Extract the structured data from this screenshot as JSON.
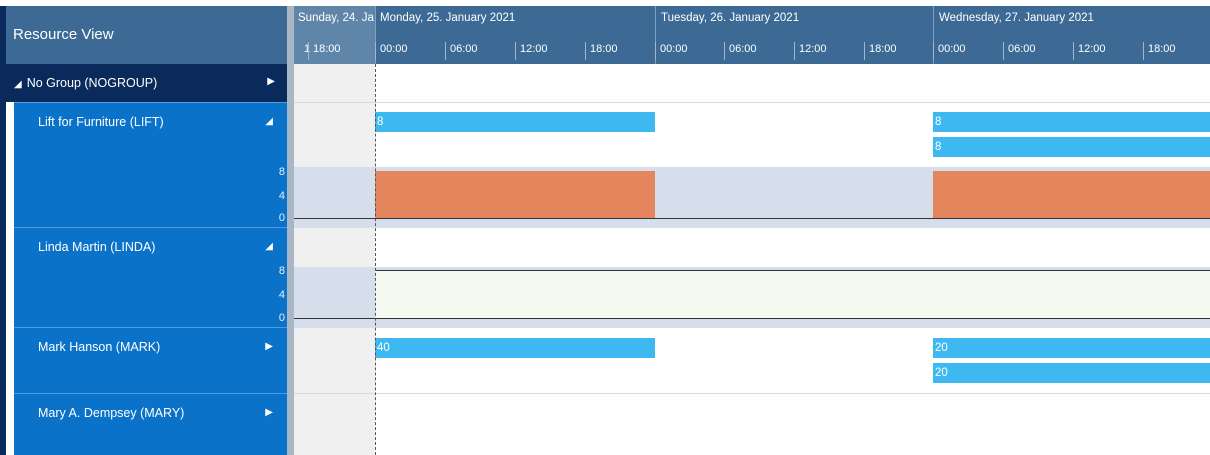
{
  "resource_view": {
    "title": "Resource View",
    "group": {
      "label": "No Group (NOGROUP)",
      "expand_glyph": "◢",
      "arrow_glyph": "▶"
    },
    "resources": [
      {
        "label": "Lift for Furniture (LIFT)",
        "toggle_glyph": "◢",
        "axis": [
          "8",
          "4",
          "0"
        ]
      },
      {
        "label": "Linda Martin (LINDA)",
        "toggle_glyph": "◢",
        "axis": [
          "8",
          "4",
          "0"
        ]
      },
      {
        "label": "Mark Hanson (MARK)",
        "toggle_glyph": "▶"
      },
      {
        "label": "Mary A. Dempsey (MARY)",
        "toggle_glyph": "▶"
      }
    ]
  },
  "timeline": {
    "days": [
      {
        "label": "Sunday, 24. Ja"
      },
      {
        "label": "Monday, 25. January 2021"
      },
      {
        "label": "Tuesday, 26. January 2021"
      },
      {
        "label": "Wednesday, 27. January 2021"
      }
    ],
    "hours": [
      "1",
      "18:00",
      "00:00",
      "06:00",
      "12:00",
      "18:00",
      "00:00",
      "06:00",
      "12:00",
      "18:00",
      "00:00",
      "06:00",
      "12:00",
      "18:00"
    ]
  },
  "bars": {
    "lift": [
      "8",
      "8",
      "8"
    ],
    "mark": [
      "40",
      "20",
      "20"
    ]
  },
  "colors": {
    "header": "#3c6a95",
    "group_row": "#0a2a5c",
    "resource_row": "#0b72c9",
    "task_bar": "#3eb8f0",
    "load_block": "#e4855e",
    "capacity_band": "#d5deea"
  }
}
